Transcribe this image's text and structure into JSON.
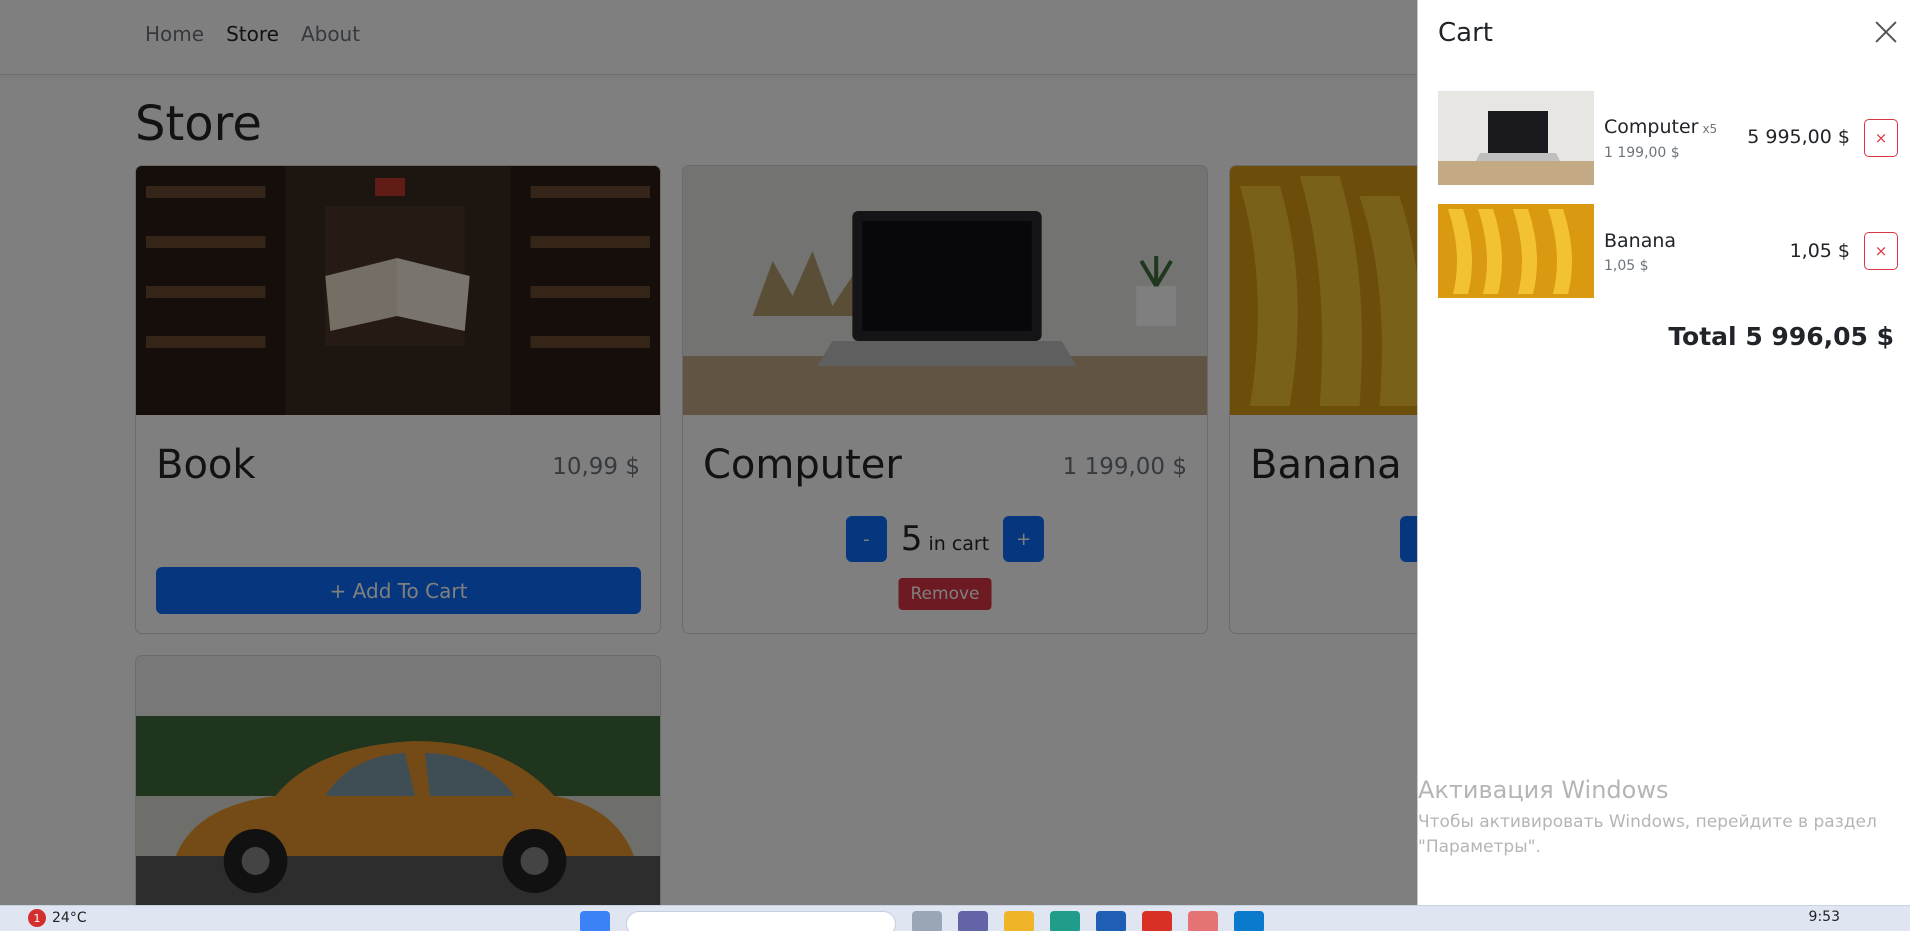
{
  "nav": {
    "items": [
      "Home",
      "Store",
      "About"
    ]
  },
  "store": {
    "title": "Store",
    "products": [
      {
        "name": "Book",
        "price": "10,99 $",
        "add_label": "+ Add To Cart"
      },
      {
        "name": "Computer",
        "price": "1 199,00 $",
        "minus_label": "-",
        "plus_label": "+",
        "quantity": "5",
        "in_cart_label": "in cart",
        "remove_label": "Remove"
      },
      {
        "name": "Banana"
      }
    ]
  },
  "cart": {
    "title": "Cart",
    "items": [
      {
        "name": "Computer",
        "qty": "x5",
        "unit_price": "1 199,00 $",
        "total": "5 995,00 $",
        "remove_label": "×"
      },
      {
        "name": "Banana",
        "unit_price": "1,05 $",
        "total": "1,05 $",
        "remove_label": "×"
      }
    ],
    "total_label": "Total 5 996,05 $"
  },
  "watermark": {
    "line1": "Активация Windows",
    "line2": "Чтобы активировать Windows, перейдите в раздел \"Параметры\"."
  },
  "taskbar": {
    "weather_badge": "1",
    "temperature": "24°C",
    "time": "9:53"
  },
  "colors": {
    "primary": "#0d6efd",
    "danger": "#dc3545",
    "overlay": "rgba(0,0,0,0.5)"
  }
}
